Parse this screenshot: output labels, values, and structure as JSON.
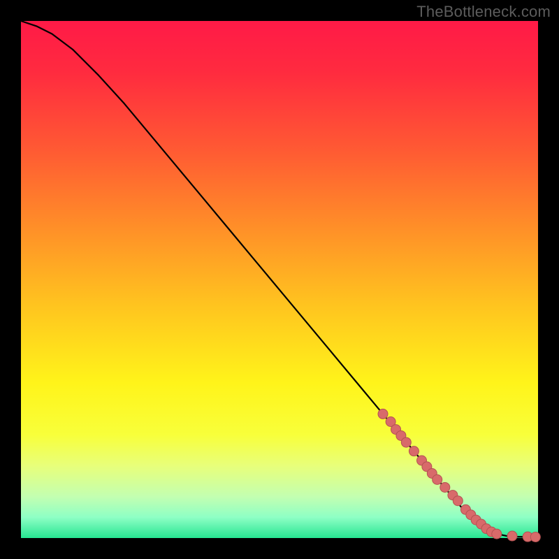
{
  "watermark": "TheBottleneck.com",
  "colors": {
    "background": "#000000",
    "curve": "#000000",
    "scatter_fill": "#d86a6a",
    "scatter_stroke": "#b45252",
    "gradient_top": "#ff1a47",
    "gradient_bottom": "#26e592"
  },
  "chart_data": {
    "type": "line",
    "title": "",
    "xlabel": "",
    "ylabel": "",
    "xlim": [
      0,
      100
    ],
    "ylim": [
      0,
      100
    ],
    "series": [
      {
        "name": "curve",
        "x": [
          0,
          3,
          6,
          10,
          15,
          20,
          25,
          30,
          35,
          40,
          45,
          50,
          55,
          60,
          65,
          70,
          75,
          80,
          83,
          86,
          88,
          90,
          92,
          94,
          96,
          98,
          100
        ],
        "y": [
          100,
          99,
          97.5,
          94.5,
          89.5,
          84,
          78,
          72,
          66,
          60,
          54,
          48,
          42,
          36,
          30,
          24,
          18,
          12,
          8.5,
          5,
          3,
          1.5,
          0.8,
          0.4,
          0.25,
          0.2,
          0.2
        ]
      }
    ],
    "scatter": {
      "name": "points",
      "x": [
        70,
        71.5,
        72.5,
        73.5,
        74.5,
        76,
        77.5,
        78.5,
        79.5,
        80.5,
        82,
        83.5,
        84.5,
        86,
        87,
        88,
        89,
        90,
        91,
        92,
        95,
        98,
        99.5
      ],
      "y": [
        24,
        22.5,
        21,
        19.8,
        18.5,
        16.8,
        15,
        13.8,
        12.5,
        11.3,
        9.8,
        8.3,
        7.2,
        5.5,
        4.5,
        3.5,
        2.7,
        1.8,
        1.2,
        0.8,
        0.4,
        0.25,
        0.2
      ]
    }
  }
}
